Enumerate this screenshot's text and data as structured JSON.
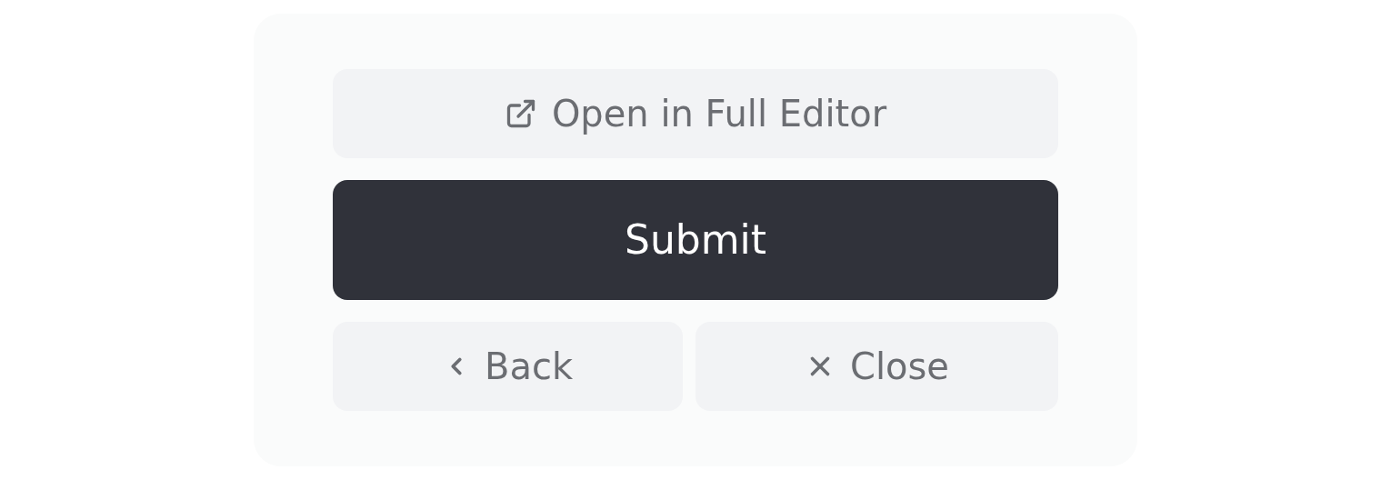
{
  "open_editor": {
    "label": "Open in Full Editor"
  },
  "submit": {
    "label": "Submit"
  },
  "back": {
    "label": "Back"
  },
  "close": {
    "label": "Close"
  }
}
